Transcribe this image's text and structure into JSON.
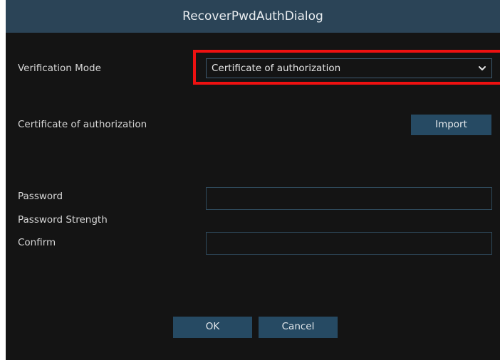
{
  "dialog": {
    "title": "RecoverPwdAuthDialog"
  },
  "verification_mode": {
    "label": "Verification Mode",
    "selected_value": "Certificate of authorization",
    "icon": "chevron-down-icon"
  },
  "certificate": {
    "label": "Certificate of authorization",
    "import_label": "Import"
  },
  "password": {
    "label": "Password",
    "value": ""
  },
  "password_strength": {
    "label": "Password Strength"
  },
  "confirm": {
    "label": "Confirm",
    "value": ""
  },
  "footer": {
    "ok_label": "OK",
    "cancel_label": "Cancel"
  },
  "colors": {
    "titlebar": "#2b4457",
    "background": "#141414",
    "button": "#264a63",
    "highlight": "#ee1111"
  }
}
